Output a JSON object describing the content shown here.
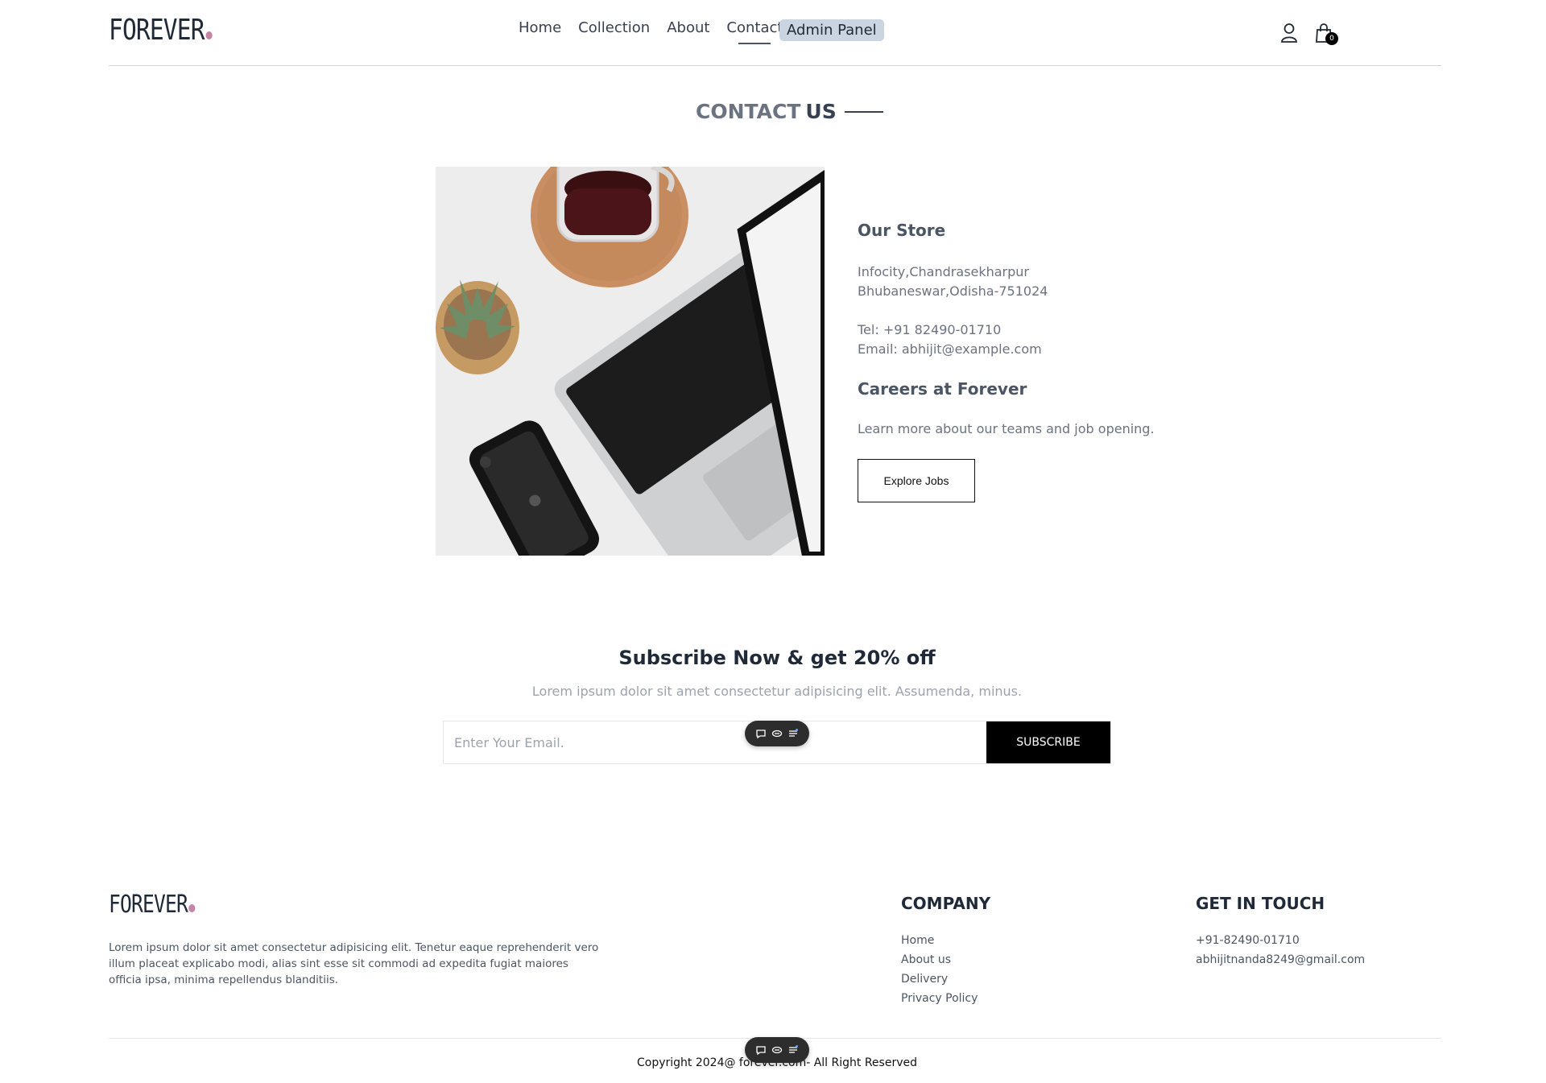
{
  "brand": {
    "logo_text": "FOREVER",
    "dot_color": "#c586a5"
  },
  "nav": {
    "links": [
      "Home",
      "Collection",
      "About",
      "Contact"
    ],
    "active": "Contact",
    "admin_label": "Admin Panel",
    "cart_count": "0"
  },
  "page": {
    "title_light": "CONTACT",
    "title_bold": "US"
  },
  "store": {
    "title": "Our Store",
    "address_line1": "Infocity,Chandrasekharpur",
    "address_line2": "Bhubaneswar,Odisha-751024",
    "tel": "Tel: +91 82490-01710",
    "email": "Email: abhijit@example.com"
  },
  "careers": {
    "title": "Careers at Forever",
    "text": "Learn more about our teams and job opening.",
    "button": "Explore Jobs"
  },
  "subscribe": {
    "title": "Subscribe Now & get 20% off",
    "text": "Lorem ipsum dolor sit amet consectetur adipisicing elit. Assumenda, minus.",
    "placeholder": "Enter Your Email.",
    "button": "SUBSCRIBE"
  },
  "footer": {
    "logo_text": "FOREVER",
    "description": "Lorem ipsum dolor sit amet consectetur adipisicing elit. Tenetur eaque reprehenderit vero illum placeat explicabo modi, alias sint esse sit commodi ad expedita fugiat maiores officia ipsa, minima repellendus blanditiis.",
    "company_title": "COMPANY",
    "company_links": [
      "Home",
      "About us",
      "Delivery",
      "Privacy Policy"
    ],
    "touch_title": "GET IN TOUCH",
    "phone": "+91-82490-01710",
    "email": "abhijitnanda8249@gmail.com",
    "copyright": "Copyright 2024@ forever.com- All Right Reserved"
  }
}
